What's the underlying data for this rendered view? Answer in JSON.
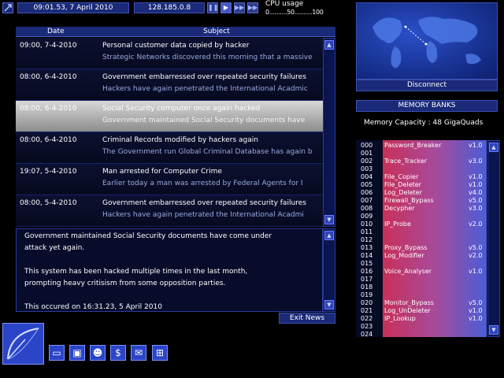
{
  "status": {
    "datetime": "09:01.53, 7 April 2010",
    "ip": "128.185.0.8",
    "cpu_label": "CPU usage",
    "cpu_scale": "0..........50..........100"
  },
  "controls": [
    "pause",
    "play",
    "fast",
    "fastest"
  ],
  "news": {
    "col_date": "Date",
    "col_subject": "Subject",
    "items": [
      {
        "date": "09:00, 7-4-2010",
        "subject": "Personal customer data copied by hacker",
        "summary": "Strategic Networks discovered this morning that a massive"
      },
      {
        "date": "08:00, 6-4-2010",
        "subject": "Government embarressed over repeated security failures",
        "summary": "Hackers have again penetrated the International Acadmic"
      },
      {
        "date": "08:00, 6-4-2010",
        "subject": "Social Security computer once again hacked",
        "summary": "Government maintained Social Security documents have"
      },
      {
        "date": "08:00, 6-4-2010",
        "subject": "Criminal Records modified by hackers again",
        "summary": "The Government run Global Criminal Database has again b"
      },
      {
        "date": "19:07, 5-4-2010",
        "subject": "Man arrested for Computer Crime",
        "summary": "Earlier today a man was arrested by Federal Agents for I"
      },
      {
        "date": "08:00, 5-4-2010",
        "subject": "Government embarressed over repeated security failures",
        "summary": "Hackers have again penetrated the International Acadmi"
      }
    ],
    "detail": {
      "p1": "Government maintained Social Security documents have come under",
      "p2": "attack yet again.",
      "p3": "This system has been hacked multiple times in the last month,",
      "p4": "prompting heavy critisism from some opposition parties.",
      "p5": "This occured on 16:31.23, 5 April 2010"
    },
    "exit_label": "Exit News"
  },
  "toolbar": {
    "icons": [
      "computer-icon",
      "floppy-disk-icon",
      "people-icon",
      "dollar-icon",
      "email-icon",
      "network-icon"
    ],
    "glyphs": [
      "▭",
      "▣",
      "☻",
      "$",
      "✉",
      "⊞"
    ]
  },
  "disconnect_label": "Disconnect",
  "memory": {
    "title": "MEMORY BANKS",
    "capacity": "Memory Capacity : 48 GigaQuads",
    "slots": [
      {
        "idx": "000",
        "name": "Password_Breaker",
        "ver": "v1.0"
      },
      {
        "idx": "001",
        "name": "",
        "ver": ""
      },
      {
        "idx": "002",
        "name": "Trace_Tracker",
        "ver": "v3.0"
      },
      {
        "idx": "003",
        "name": "",
        "ver": ""
      },
      {
        "idx": "004",
        "name": "File_Copier",
        "ver": "v1.0"
      },
      {
        "idx": "005",
        "name": "File_Deleter",
        "ver": "v1.0"
      },
      {
        "idx": "006",
        "name": "Log_Deleter",
        "ver": "v4.0"
      },
      {
        "idx": "007",
        "name": "Firewall_Bypass",
        "ver": "v5.0"
      },
      {
        "idx": "008",
        "name": "Decypher",
        "ver": "v3.0"
      },
      {
        "idx": "009",
        "name": "",
        "ver": ""
      },
      {
        "idx": "010",
        "name": "IP_Probe",
        "ver": "v2.0"
      },
      {
        "idx": "011",
        "name": "",
        "ver": ""
      },
      {
        "idx": "012",
        "name": "",
        "ver": ""
      },
      {
        "idx": "013",
        "name": "Proxy_Bypass",
        "ver": "v5.0"
      },
      {
        "idx": "014",
        "name": "Log_Modifier",
        "ver": "v2.0"
      },
      {
        "idx": "015",
        "name": "",
        "ver": ""
      },
      {
        "idx": "016",
        "name": "Voice_Analyser",
        "ver": "v1.0"
      },
      {
        "idx": "017",
        "name": "",
        "ver": ""
      },
      {
        "idx": "018",
        "name": "",
        "ver": ""
      },
      {
        "idx": "019",
        "name": "",
        "ver": ""
      },
      {
        "idx": "020",
        "name": "Monitor_Bypass",
        "ver": "v5.0"
      },
      {
        "idx": "021",
        "name": "Log_UnDeleter",
        "ver": "v1.0"
      },
      {
        "idx": "022",
        "name": "IP_Lookup",
        "ver": "v1.0"
      },
      {
        "idx": "023",
        "name": "",
        "ver": ""
      },
      {
        "idx": "024",
        "name": "",
        "ver": ""
      }
    ]
  }
}
